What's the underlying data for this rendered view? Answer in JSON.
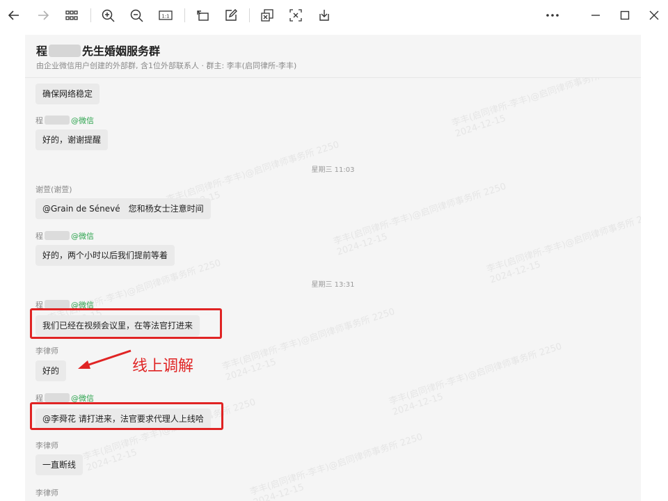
{
  "toolbar": {
    "icons": [
      "arrow-left-icon",
      "arrow-right-icon",
      "grid-icon",
      "zoom-in-icon",
      "zoom-out-icon",
      "actual-size-icon",
      "rotate-icon",
      "edit-icon",
      "extract-text-icon",
      "translate-icon",
      "download-icon",
      "more-icon",
      "minimize-icon",
      "maximize-icon",
      "close-icon"
    ],
    "actual_size": "1:1"
  },
  "chat": {
    "title_prefix": "程",
    "title_suffix": "先生婚姻服务群",
    "subtitle": "由企业微信用户创建的外部群, 含1位外部联系人 · 群主: 李丰(启同律所-李丰)"
  },
  "messages": [
    {
      "sender": "",
      "text": "确保网络稳定"
    },
    {
      "sender": "程",
      "tag": "@微信",
      "text": "好的，谢谢提醒"
    },
    {
      "time": "星期三 11:03"
    },
    {
      "sender": "谢萱(谢萱)",
      "text": "@Grain de Sénevé　您和杨女士注意时间"
    },
    {
      "sender": "程",
      "tag": "@微信",
      "text": "好的，两个小时以后我们提前等着"
    },
    {
      "time": "星期三 13:31"
    },
    {
      "sender": "程",
      "tag": "@微信",
      "text": "我们已经在视频会议里，在等法官打进来"
    },
    {
      "sender": "李律师",
      "text": "好的"
    },
    {
      "sender": "程",
      "tag": "@微信",
      "text": "@李舜花 请打进来，法官要求代理人上线哈"
    },
    {
      "sender": "李律师",
      "text": "一直断线"
    },
    {
      "sender": "李律师"
    }
  ],
  "annotation": {
    "text": "线上调解",
    "color": "#e02424"
  },
  "watermark": {
    "line1": "李丰(启同律所-李丰)@启同律师事务所 2250",
    "line2": "2024-12-15"
  },
  "colors": {
    "wechat_tag": "#2ea44f",
    "highlight": "#e02424",
    "bubble": "#eaeaea"
  }
}
